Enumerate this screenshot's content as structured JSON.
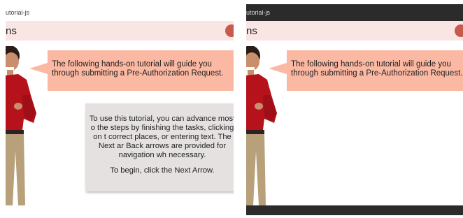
{
  "left_view": {
    "tab_label": "utorial-js",
    "header_title": "ns",
    "callout_text": "The following hands-on tutorial will guide you through submitting a Pre-Authorization Request.",
    "instructions_paragraph": "To use this tutorial, you can advance most o the steps by finishing the tasks, clicking on t correct places, or entering text. The Next ar Back arrows are provided for navigation wh necessary.",
    "instructions_begin": "To begin, click the Next Arrow."
  },
  "right_view": {
    "tab_label": "utorial-js",
    "header_title": "ns",
    "callout_text": "The following hands-on tutorial will guide you through submitting a Pre-Authorization Request."
  },
  "colors": {
    "header_band": "#f9e5e3",
    "callout": "#fbb8a2",
    "instructions_box": "#e5e1e1",
    "menu_accent": "#c65a4c",
    "dark_chrome": "#2b2b2b",
    "presenter_shirt": "#b5121b",
    "presenter_pants": "#b7a07a"
  }
}
